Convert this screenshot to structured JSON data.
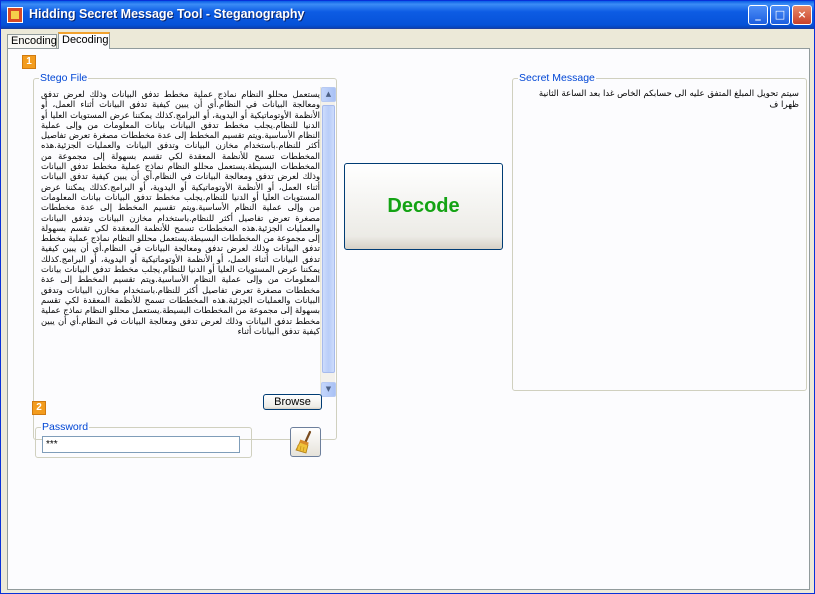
{
  "window": {
    "title": "Hidding Secret Message Tool - Steganography",
    "controls": {
      "minimize": "_",
      "maximize": "□",
      "close": "×"
    }
  },
  "tabs": [
    {
      "label": "Encoding",
      "selected": false
    },
    {
      "label": "Decoding",
      "selected": true
    }
  ],
  "steps": {
    "one": "1",
    "two": "2"
  },
  "stego": {
    "label": "Stego File",
    "content": "يستعمل محللو النظام نماذج عملية مخطط تدفق البيانات وذلك لعرض تدفق ومعالجة البيانات في النظام.أي أن يبين كيفية تدفق البيانات أثناء العمل، أو الأنظمة الأوتوماتيكية أو اليدوية، أو البرامج.كذلك يمكننا عرض المستويات العليا أو الدنيا للنظام.يجلب مخطط تدفق البيانات بيانات المعلومات من وإلى عملية النظام الأساسية.ويتم تقسيم المخطط إلى عدة مخططات مصغرة تعرض تفاصيل أكثر للنظام.باستخدام مخازن البيانات وتدفق البيانات والعمليات الجزئية.هذه المخططات تسمح للأنظمة المعقدة لكي تقسم بسهولة إلى مجموعة من المخططات البسيطة.يستعمل محللو النظام نماذج عملية مخطط تدفق البيانات وذلك لعرض تدفق ومعالجة البيانات في النظام.أي أن يبين كيفية تدفق البيانات أثناء العمل، أو الأنظمة الأوتوماتيكية أو اليدوية، أو البرامج.كذلك يمكننا عرض المستويات العليا أو الدنيا للنظام.يجلب مخطط تدفق البيانات بيانات المعلومات من وإلى عملية النظام الأساسية.ويتم تقسيم المخطط إلى عدة مخططات مصغرة تعرض تفاصيل أكثر للنظام.باستخدام مخازن البيانات وتدفق البيانات والعمليات الجزئية.هذه المخططات تسمح للأنظمة المعقدة لكي تقسم بسهولة إلى مجموعة من المخططات البسيطة.يستعمل محللو النظام نماذج عملية مخطط تدفق البيانات وذلك لعرض تدفق ومعالجة البيانات في النظام.أي أن يبين كيفية تدفق البيانات أثناء العمل، أو الأنظمة الأوتوماتيكية أو اليدوية، أو البرامج.كذلك يمكننا عرض المستويات العليا أو الدنيا للنظام.يجلب مخطط تدفق البيانات بيانات المعلومات من وإلى عملية النظام الأساسية.ويتم تقسيم المخطط إلى عدة مخططات مصغرة تعرض تفاصيل أكثر للنظام.باستخدام مخازن البيانات وتدفق البيانات والعمليات الجزئية.هذه المخططات تسمح للأنظمة المعقدة لكي تقسم بسهولة إلى مجموعة من المخططات البسيطة.يستعمل محللو النظام نماذج عملية مخطط تدفق البيانات وذلك لعرض تدفق ومعالجة البيانات في النظام.أي أن يبين كيفية تدفق البيانات أثناء",
    "browse_label": "Browse"
  },
  "password": {
    "label": "Password",
    "value": "***"
  },
  "decode_label": "Decode",
  "secret": {
    "label": "Secret Message",
    "content": "سيتم تحويل المبلغ المتفق عليه الى حسابكم الخاص غدا بعد الساعة الثانية ظهرا ف"
  },
  "icons": {
    "clear": "broom-icon",
    "app": "app-icon"
  },
  "colors": {
    "accent_tab": "#f2a22e",
    "step_badge": "#f39c1e",
    "group_label": "#0046d5",
    "decode_text": "#14a314"
  }
}
